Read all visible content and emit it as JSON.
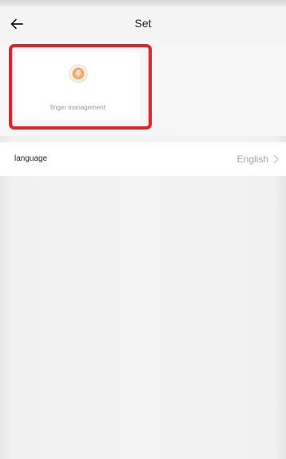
{
  "header": {
    "title": "Set",
    "back_icon": "arrow-left-icon"
  },
  "tiles": [
    {
      "label": "finger management",
      "icon": "fingerprint-icon",
      "icon_color": "#f2a96b"
    }
  ],
  "highlight_color": "#e3222c",
  "settings": {
    "language": {
      "label": "language",
      "value": "English",
      "chevron": "chevron-right-icon"
    }
  }
}
